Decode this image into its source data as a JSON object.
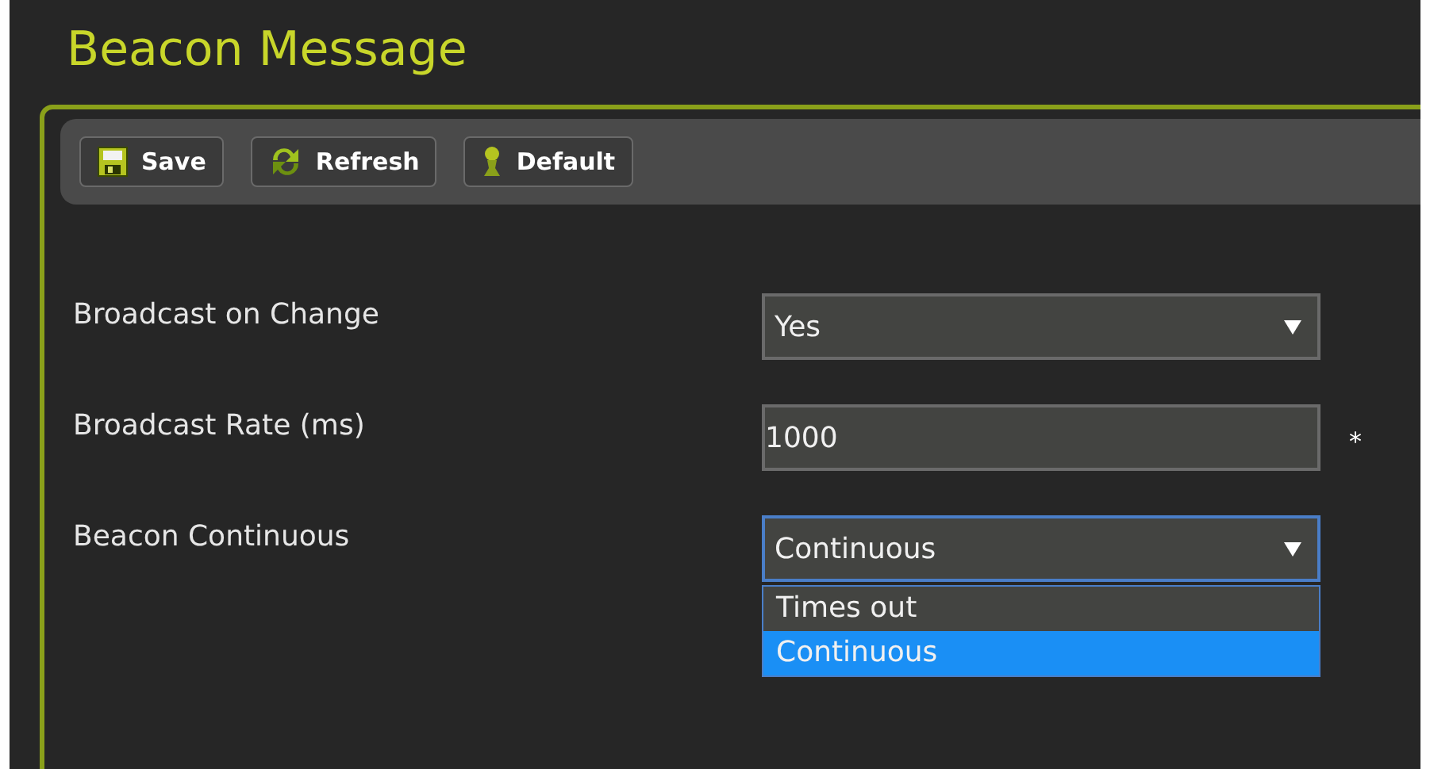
{
  "title": "Beacon Message",
  "toolbar": [
    {
      "label": "Save"
    },
    {
      "label": "Refresh"
    },
    {
      "label": "Default"
    }
  ],
  "fields": [
    {
      "label": "Broadcast on Change",
      "kind": "select",
      "value": "Yes",
      "focused": false
    },
    {
      "label": "Broadcast Rate (ms)",
      "kind": "text",
      "value": "1000",
      "focused": false,
      "required_mark": "*"
    },
    {
      "label": "Beacon Continuous",
      "kind": "select",
      "value": "Continuous",
      "focused": true,
      "options": [
        {
          "label": "Times out",
          "selected": false
        },
        {
          "label": "Continuous",
          "selected": true
        }
      ]
    }
  ]
}
